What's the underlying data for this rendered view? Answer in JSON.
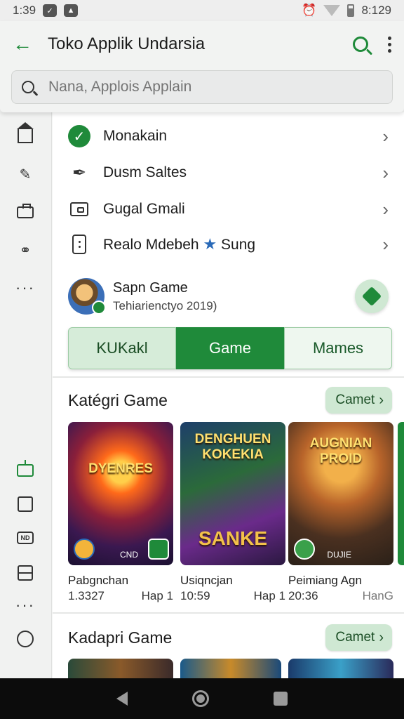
{
  "status": {
    "time": "1:39",
    "right_time": "8:129"
  },
  "appbar": {
    "title": "Toko Applik Undarsia",
    "search_placeholder": "Nana, Applois Applain"
  },
  "list": [
    {
      "label": "Monakain",
      "icon": "check-circle-icon"
    },
    {
      "label": "Dusm Saltes",
      "icon": "pen-icon"
    },
    {
      "label": "Gugal Gmali",
      "icon": "wallet-icon"
    },
    {
      "label": "Realo Mdebeh",
      "suffix": "Sung",
      "icon": "phone-icon"
    }
  ],
  "app": {
    "name": "Sapn Game",
    "subtitle": "Tehiarienctyo 2019)"
  },
  "segments": [
    "KUKakl",
    "Game",
    "Mames"
  ],
  "section1": {
    "title": "Katégri Game",
    "button": "Camet",
    "cards": [
      {
        "art_title": "DYENRES",
        "art_code": "CND",
        "name": "Pabgnchan",
        "meta_left": "1.3327",
        "meta_right": "Hap 1"
      },
      {
        "art_title": "DENGHUEN KOKEKIA",
        "art_title2": "SANKE",
        "name": "Usiqncjan",
        "meta_left": "10:59",
        "meta_right": "Hap 1"
      },
      {
        "art_title": "AUGNIAN PROID",
        "art_code": "DUJIE",
        "name": "Peimiang Agn",
        "meta_left": "20:36",
        "meta_right": "HanG"
      }
    ]
  },
  "section2": {
    "title": "Kadapri Game",
    "button": "Camet"
  },
  "colors": {
    "accent": "#1f8a3a",
    "accent_light": "#cfe8d3"
  }
}
